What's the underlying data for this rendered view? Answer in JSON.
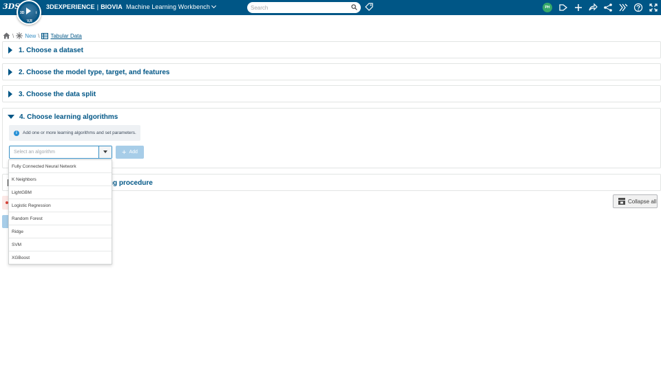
{
  "topbar": {
    "brand_prefix": "3DEXPERIENCE",
    "brand_separator": "|",
    "brand_company": "BIOVIA",
    "app_name": "Machine Learning Workbench",
    "search_placeholder": "Search",
    "compass_left": "3D",
    "compass_right": "i",
    "compass_bottom": "V,R",
    "avatar_initials": "PH",
    "ds_logo": "3DS",
    "background": "#005686"
  },
  "breadcrumb": {
    "separator": "\\",
    "new_label": "New",
    "current_label": "Tabular Data"
  },
  "sections": [
    {
      "title": "1. Choose a dataset",
      "expanded": false
    },
    {
      "title": "2. Choose the model type, target, and features",
      "expanded": false
    },
    {
      "title": "3. Choose the data split",
      "expanded": false
    },
    {
      "title": "4. Choose learning algorithms",
      "expanded": true
    }
  ],
  "section4": {
    "info_icon": "i",
    "info_text": "Add one or more learning algorithms and set parameters.",
    "select_placeholder": "Select an algorithm",
    "add_label": "Add"
  },
  "section5_partial_title": "ning procedure",
  "collapse_all_label": "Collapse all",
  "dropdown": {
    "options": [
      "Fully Connected Neural Network",
      "K Neighbors",
      "LightGBM",
      "Logistic Regression",
      "Random Forest",
      "Ridge",
      "SVM",
      "XGBoost"
    ]
  },
  "colors": {
    "accent": "#005686",
    "link": "#368ec4",
    "add_button": "#a7cde8",
    "info_background": "#eef1f4"
  }
}
